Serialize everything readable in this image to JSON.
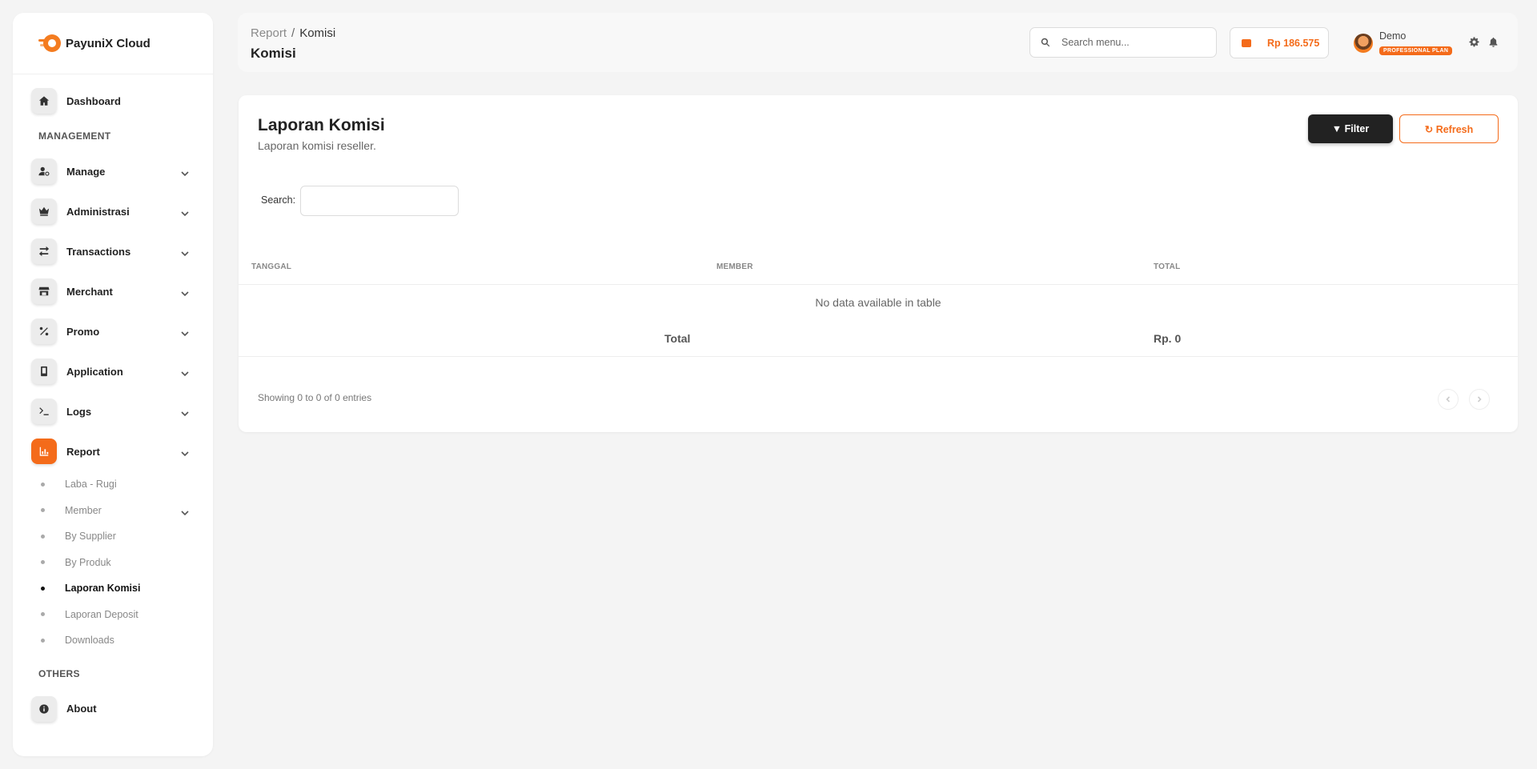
{
  "brand": {
    "name": "PayuniX Cloud"
  },
  "sidebar": {
    "dashboard": "Dashboard",
    "section_management": "MANAGEMENT",
    "items": [
      {
        "label": "Manage",
        "icon": "user-gear-icon"
      },
      {
        "label": "Administrasi",
        "icon": "crown-icon"
      },
      {
        "label": "Transactions",
        "icon": "arrows-exchange-icon"
      },
      {
        "label": "Merchant",
        "icon": "store-icon"
      },
      {
        "label": "Promo",
        "icon": "percent-icon"
      },
      {
        "label": "Application",
        "icon": "mobile-icon"
      },
      {
        "label": "Logs",
        "icon": "terminal-icon"
      },
      {
        "label": "Report",
        "icon": "chart-icon"
      }
    ],
    "report_sub": [
      "Laba - Rugi",
      "Member",
      "By Supplier",
      "By Produk",
      "Laporan Komisi",
      "Laporan Deposit",
      "Downloads"
    ],
    "section_others": "OTHERS",
    "about": "About"
  },
  "topbar": {
    "breadcrumb_parent": "Report",
    "breadcrumb_sep": "/",
    "breadcrumb_current": "Komisi",
    "page_title": "Komisi",
    "search_placeholder": "Search menu...",
    "balance": "Rp 186.575",
    "user_name": "Demo",
    "plan": "PROFESSIONAL PLAN"
  },
  "card": {
    "title": "Laporan Komisi",
    "subtitle": "Laporan komisi reseller.",
    "filter_label": "Filter",
    "refresh_label": "Refresh",
    "search_label": "Search:",
    "columns": [
      "TANGGAL",
      "MEMBER",
      "TOTAL"
    ],
    "empty_text": "No data available in table",
    "total_label": "Total",
    "total_value": "Rp. 0",
    "showing": "Showing 0 to 0 of 0 entries"
  },
  "colors": {
    "accent": "#f46b1a",
    "dark": "#222222"
  }
}
